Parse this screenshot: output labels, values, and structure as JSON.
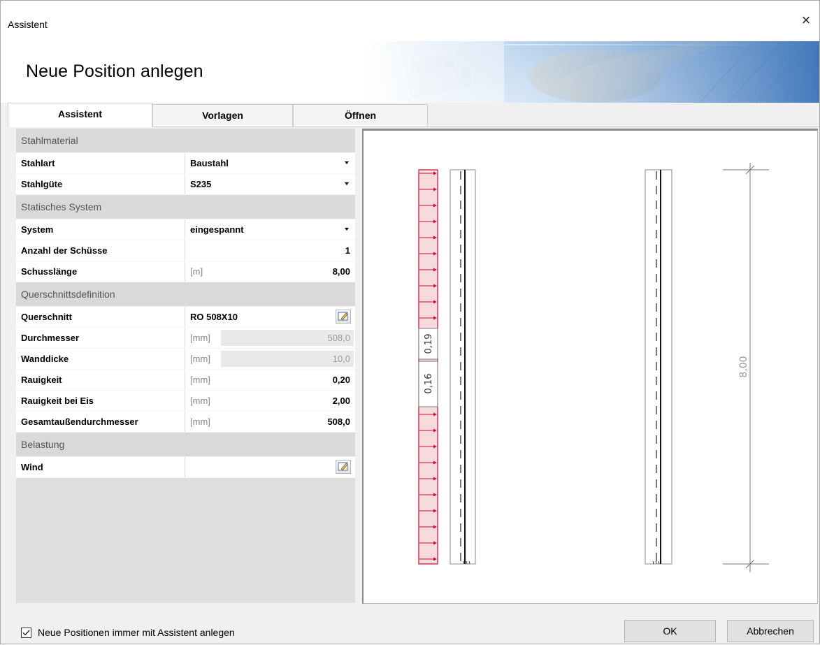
{
  "window": {
    "title": "Assistent"
  },
  "header": {
    "heading": "Neue Position anlegen"
  },
  "tabs": [
    {
      "label": "Assistent"
    },
    {
      "label": "Vorlagen"
    },
    {
      "label": "Öffnen"
    }
  ],
  "groups": {
    "material": "Stahlmaterial",
    "system": "Statisches System",
    "section": "Querschnittsdefinition",
    "load": "Belastung"
  },
  "props": {
    "stahlart": {
      "label": "Stahlart",
      "value": "Baustahl"
    },
    "stahlguete": {
      "label": "Stahlgüte",
      "value": "S235"
    },
    "system": {
      "label": "System",
      "value": "eingespannt"
    },
    "anzahl": {
      "label": "Anzahl der Schüsse",
      "value": "1"
    },
    "schusslaenge": {
      "label": "Schusslänge",
      "unit": "[m]",
      "value": "8,00"
    },
    "querschnitt": {
      "label": "Querschnitt",
      "value": "RO 508X10"
    },
    "durchmesser": {
      "label": "Durchmesser",
      "unit": "[mm]",
      "value": "508,0"
    },
    "wanddicke": {
      "label": "Wanddicke",
      "unit": "[mm]",
      "value": "10,0"
    },
    "rauigkeit": {
      "label": "Rauigkeit",
      "unit": "[mm]",
      "value": "0,20"
    },
    "rauigkeit_eis": {
      "label": "Rauigkeit bei Eis",
      "unit": "[mm]",
      "value": "2,00"
    },
    "gesamt": {
      "label": "Gesamtaußendurchmesser",
      "unit": "[mm]",
      "value": "508,0"
    },
    "wind": {
      "label": "Wind",
      "value": ""
    }
  },
  "drawing": {
    "load_label_top": "0,19",
    "load_label_bottom": "0,16",
    "height_label": "8,00",
    "load_color": "#c8102e"
  },
  "footer": {
    "checkbox_label": "Neue Positionen immer mit Assistent anlegen",
    "checkbox_checked": true,
    "ok": "OK",
    "cancel": "Abbrechen"
  }
}
